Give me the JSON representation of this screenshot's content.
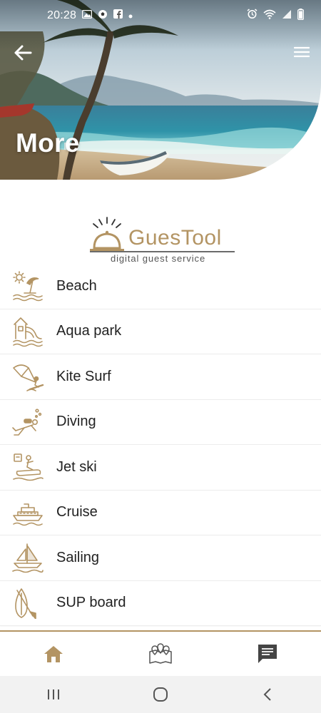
{
  "status_bar": {
    "time": "20:28",
    "left_icons": [
      "gallery-icon",
      "soccer-icon",
      "facebook-icon",
      "dot-icon"
    ],
    "right_icons": [
      "alarm-icon",
      "wifi-icon",
      "signal-icon",
      "battery-icon"
    ]
  },
  "header": {
    "title": "More",
    "back_icon": "arrow-left-icon",
    "menu_icon": "hamburger-menu-icon"
  },
  "logo": {
    "name": "GuesTool",
    "tagline": "digital guest service"
  },
  "list": {
    "items": [
      {
        "label": "Beach",
        "icon": "beach-umbrella-icon"
      },
      {
        "label": "Aqua park",
        "icon": "water-slide-icon"
      },
      {
        "label": "Kite Surf",
        "icon": "kite-surf-icon"
      },
      {
        "label": "Diving",
        "icon": "diver-icon"
      },
      {
        "label": "Jet ski",
        "icon": "jet-ski-icon"
      },
      {
        "label": "Cruise",
        "icon": "cruise-ship-icon"
      },
      {
        "label": "Sailing",
        "icon": "sailboat-icon"
      },
      {
        "label": "SUP board",
        "icon": "sup-board-icon"
      }
    ]
  },
  "bottom_nav": {
    "items": [
      {
        "name": "home",
        "icon": "home-icon",
        "active": true
      },
      {
        "name": "map",
        "icon": "map-pins-icon",
        "active": false
      },
      {
        "name": "messages",
        "icon": "chat-message-icon",
        "active": false
      }
    ]
  },
  "system_nav": {
    "items": [
      "recent-apps-icon",
      "home-circle-icon",
      "back-chevron-icon"
    ]
  },
  "colors": {
    "accent": "#b39463",
    "text": "#222222",
    "nav_dark": "#444444",
    "system_bar": "#f2f2f2"
  }
}
